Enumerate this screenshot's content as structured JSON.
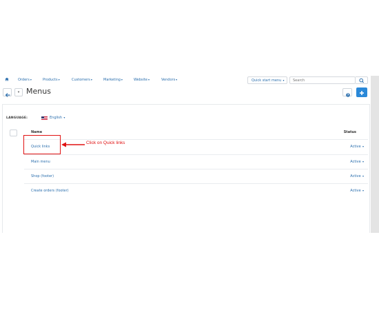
{
  "nav": {
    "items": [
      {
        "label": "Orders"
      },
      {
        "label": "Products"
      },
      {
        "label": "Customers"
      },
      {
        "label": "Marketing"
      },
      {
        "label": "Website"
      },
      {
        "label": "Vendors"
      }
    ],
    "quick_start_label": "Quick start menu",
    "search_placeholder": "Search",
    "home_icon": "home-icon",
    "search_icon": "search-icon"
  },
  "toolbar": {
    "title": "Menus",
    "back_icon": "arrow-left-icon",
    "help_icon": "help-icon",
    "add_icon": "plus-icon"
  },
  "language": {
    "label": "LANGUAGE:",
    "value": "English"
  },
  "table": {
    "header_name": "Name",
    "header_status": "Status",
    "rows": [
      {
        "name": "Quick links",
        "status": "Active"
      },
      {
        "name": "Main menu",
        "status": "Active"
      },
      {
        "name": "Shop (footer)",
        "status": "Active"
      },
      {
        "name": "Create orders (footer)",
        "status": "Active"
      }
    ]
  },
  "annotation": {
    "text": "Click on  Quick links"
  },
  "colors": {
    "link": "#2a6ead",
    "primary_button": "#2a88d8",
    "annotation": "#e01010"
  }
}
